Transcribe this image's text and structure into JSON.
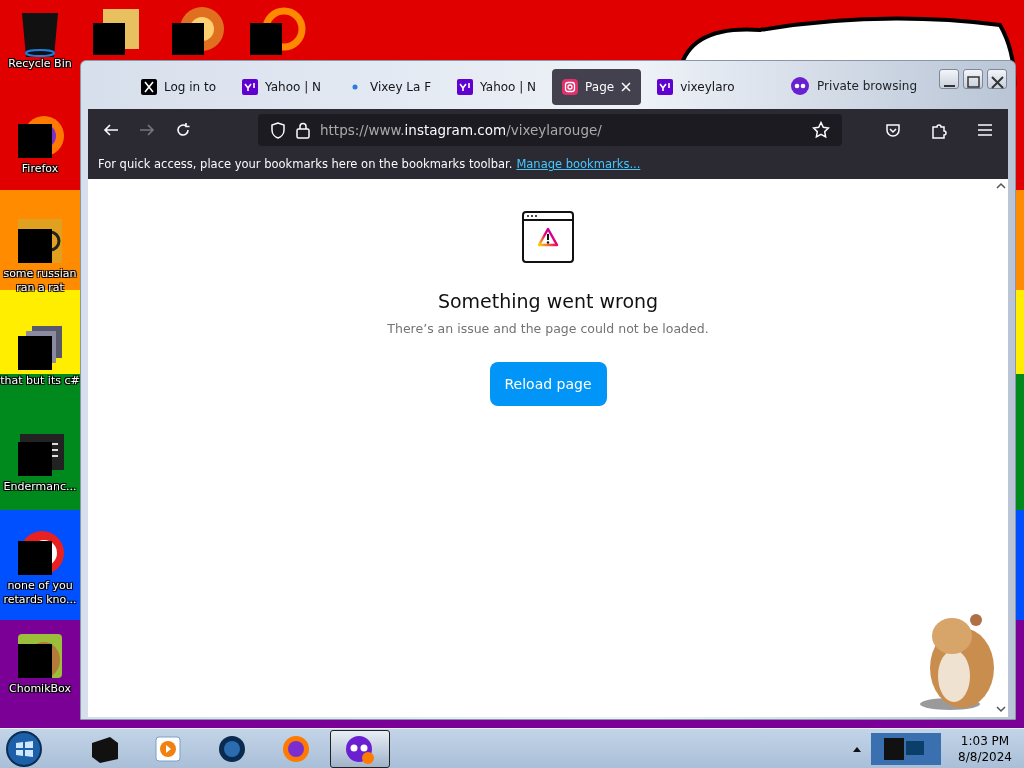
{
  "desktop": {
    "icons": [
      {
        "label": "Recycle Bin",
        "kind": "bin"
      },
      {
        "label": "Firefox",
        "kind": "firefox"
      },
      {
        "label": "some russian ran a rat",
        "kind": "doc"
      },
      {
        "label": "that but its c#",
        "kind": "stack"
      },
      {
        "label": "Endermanc...",
        "kind": "console"
      },
      {
        "label": "none of you retards kno...",
        "kind": "ring"
      },
      {
        "label": "ChomikBox",
        "kind": "hamster"
      }
    ]
  },
  "browser": {
    "tabs": [
      {
        "title": "Log in to",
        "kind": "x",
        "selected": false
      },
      {
        "title": "Yahoo | N",
        "kind": "yahoo",
        "selected": false
      },
      {
        "title": "Vixey La F",
        "kind": "dot",
        "selected": false
      },
      {
        "title": "Yahoo | N",
        "kind": "yahoo",
        "selected": false
      },
      {
        "title": "Page",
        "kind": "instagram",
        "selected": true
      },
      {
        "title": "vixeylaro",
        "kind": "yahoo",
        "selected": false
      }
    ],
    "private_label": "Private browsing",
    "url": {
      "prefix": "https://www.",
      "domain": "instagram.com",
      "path": "/vixeylarouge/"
    },
    "bookmarks_bar": {
      "message": "For quick access, place your bookmarks here on the bookmarks toolbar.",
      "link": "Manage bookmarks..."
    },
    "page": {
      "heading": "Something went wrong",
      "message": "There’s an issue and the page could not be loaded.",
      "button": "Reload page"
    }
  },
  "taskbar": {
    "items": [
      {
        "kind": "box",
        "selected": false
      },
      {
        "kind": "media",
        "selected": false
      },
      {
        "kind": "globe",
        "selected": false
      },
      {
        "kind": "firefox",
        "selected": false
      },
      {
        "kind": "private",
        "selected": true
      }
    ],
    "time": "1:03 PM",
    "date": "8/8/2024"
  }
}
